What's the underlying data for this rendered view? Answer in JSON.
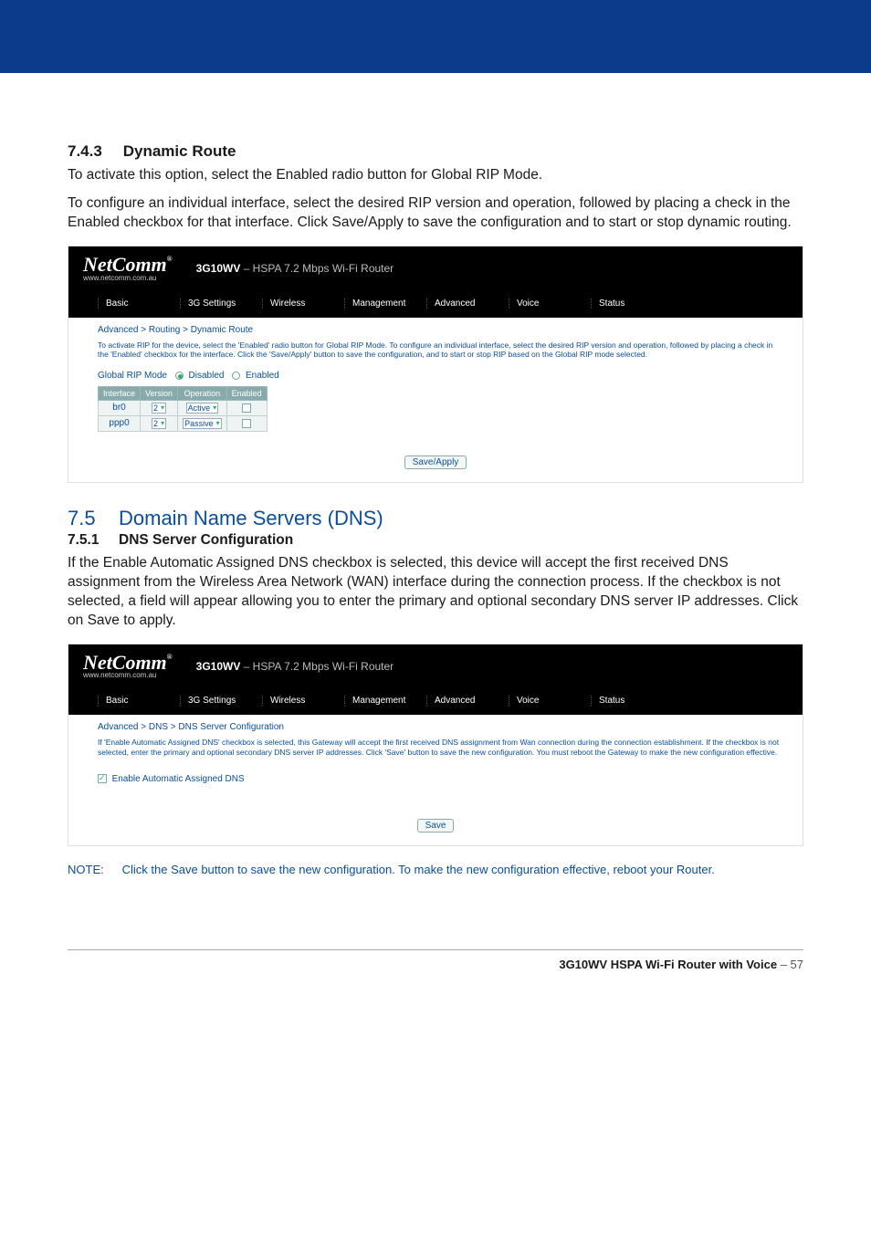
{
  "section743": {
    "heading_num": "7.4.3",
    "heading_text": "Dynamic Route",
    "p1": "To activate this option, select the Enabled radio button for Global RIP Mode.",
    "p2": "To configure an individual interface, select the desired RIP version and operation, followed by placing a check in the Enabled checkbox for that interface. Click Save/Apply to save the configuration and to start or stop dynamic routing."
  },
  "shot1": {
    "logo_text": "NetComm",
    "logo_mark": "®",
    "logo_url": "www.netcomm.com.au",
    "model_bold": "3G10WV",
    "model_rest": " – HSPA 7.2 Mbps Wi-Fi Router",
    "nav": [
      "Basic",
      "3G Settings",
      "Wireless",
      "Management",
      "Advanced",
      "Voice",
      "Status"
    ],
    "breadcrumb": "Advanced > Routing > Dynamic Route",
    "desc": "To activate RIP for the device, select the 'Enabled' radio button for Global RIP Mode. To configure an individual interface, select the desired RIP version and operation, followed by placing a check in the 'Enabled' checkbox for the interface. Click the 'Save/Apply' button to save the configuration, and to start or stop RIP based on the Global RIP mode selected.",
    "grm_label": "Global RIP Mode",
    "grm_disabled": "Disabled",
    "grm_enabled": "Enabled",
    "table": {
      "headers": [
        "Interface",
        "Version",
        "Operation",
        "Enabled"
      ],
      "rows": [
        {
          "iface": "br0",
          "ver": "2",
          "op": "Active",
          "en": false
        },
        {
          "iface": "ppp0",
          "ver": "2",
          "op": "Passive",
          "en": false
        }
      ]
    },
    "save_btn": "Save/Apply"
  },
  "section75": {
    "h2_num": "7.5",
    "h2_text": "Domain Name Servers (DNS)",
    "h3_num": "7.5.1",
    "h3_text": "DNS Server Configuration",
    "p1a": "If the Enable Automatic Assigned DNS checkbox is selected, this device will accept the first received DNS assignment from the Wireless Area Network (WAN) interface during the connection process. If the checkbox is not selected, a field will appear allowing you to enter the primary and optional secondary DNS server IP addresses. Click on ",
    "p1b": "Save",
    "p1c": " to apply."
  },
  "shot2": {
    "breadcrumb": "Advanced > DNS > DNS Server Configuration",
    "desc": "If 'Enable Automatic Assigned DNS' checkbox is selected, this Gateway will accept the first received DNS assignment from Wan connection during the connection establishment. If the checkbox is not selected, enter the primary and optional secondary DNS server IP addresses. Click 'Save' button to save the new configuration. You must reboot the Gateway to make the new configuration effective.",
    "checkbox_label": "Enable Automatic Assigned DNS",
    "save_btn": "Save"
  },
  "note": {
    "label": "NOTE:",
    "text": "Click the Save button to save the new configuration. To make the new configuration effective, reboot your Router."
  },
  "footer": {
    "product": "3G10WV HSPA Wi-Fi Router with Voice",
    "page": " – 57"
  }
}
